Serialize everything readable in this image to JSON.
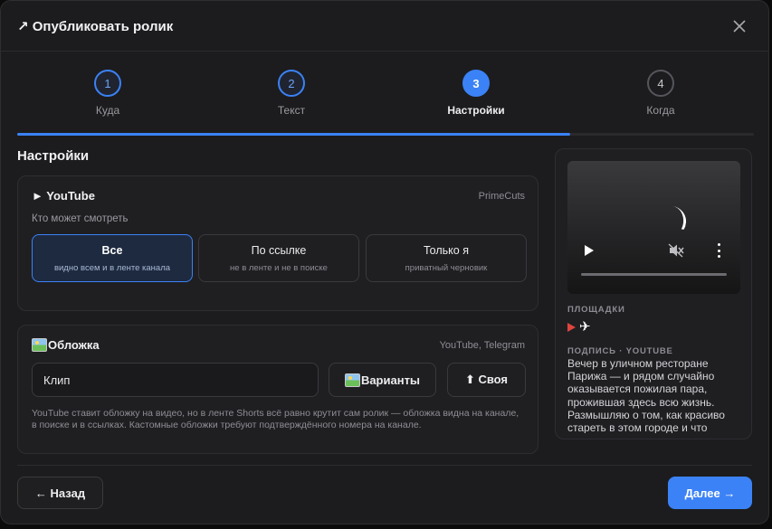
{
  "header": {
    "title": "↗ Опубликовать ролик",
    "close_icon": "close-icon"
  },
  "stepper": {
    "steps": [
      {
        "number": "1",
        "label": "Куда",
        "state": "done"
      },
      {
        "number": "2",
        "label": "Текст",
        "state": "done"
      },
      {
        "number": "3",
        "label": "Настройки",
        "state": "active"
      },
      {
        "number": "4",
        "label": "Когда",
        "state": "todo"
      }
    ],
    "progress_percent": 75
  },
  "settings": {
    "title": "Настройки",
    "youtube": {
      "heading": "► YouTube",
      "channel": "PrimeCuts",
      "who_label": "Кто может смотреть",
      "options": [
        {
          "title": "Все",
          "subtitle": "видно всем и в ленте канала",
          "selected": true
        },
        {
          "title": "По ссылке",
          "subtitle": "не в ленте и не в поиске",
          "selected": false
        },
        {
          "title": "Только я",
          "subtitle": "приватный черновик",
          "selected": false
        }
      ]
    },
    "cover": {
      "heading": "Обложка",
      "platforms": "YouTube, Telegram",
      "input_value": "Клип",
      "variants_label": "Варианты",
      "own_label": "⬆ Своя",
      "note": "YouTube ставит обложку на видео, но в ленте Shorts всё равно крутит сам ролик — обложка видна на канале, в поиске и в ссылках. Кастомные обложки требуют подтверждённого номера на канале."
    }
  },
  "preview": {
    "platforms_label": "ПЛОЩАДКИ",
    "platform_icons": [
      "youtube-icon",
      "telegram-icon"
    ],
    "caption_label": "ПОДПИСЬ · YOUTUBE",
    "caption_text": "Вечер в уличном ресторане Парижа — и рядом случайно оказывается пожилая пара, прожившая здесь всю жизнь. Размышляю о том, как красиво стареть в этом городе и что"
  },
  "footer": {
    "back_label": "← Назад",
    "next_label": "Далее →"
  },
  "colors": {
    "accent": "#3b82f6",
    "background": "#1c1c1e",
    "youtube_red": "#e0443e"
  }
}
